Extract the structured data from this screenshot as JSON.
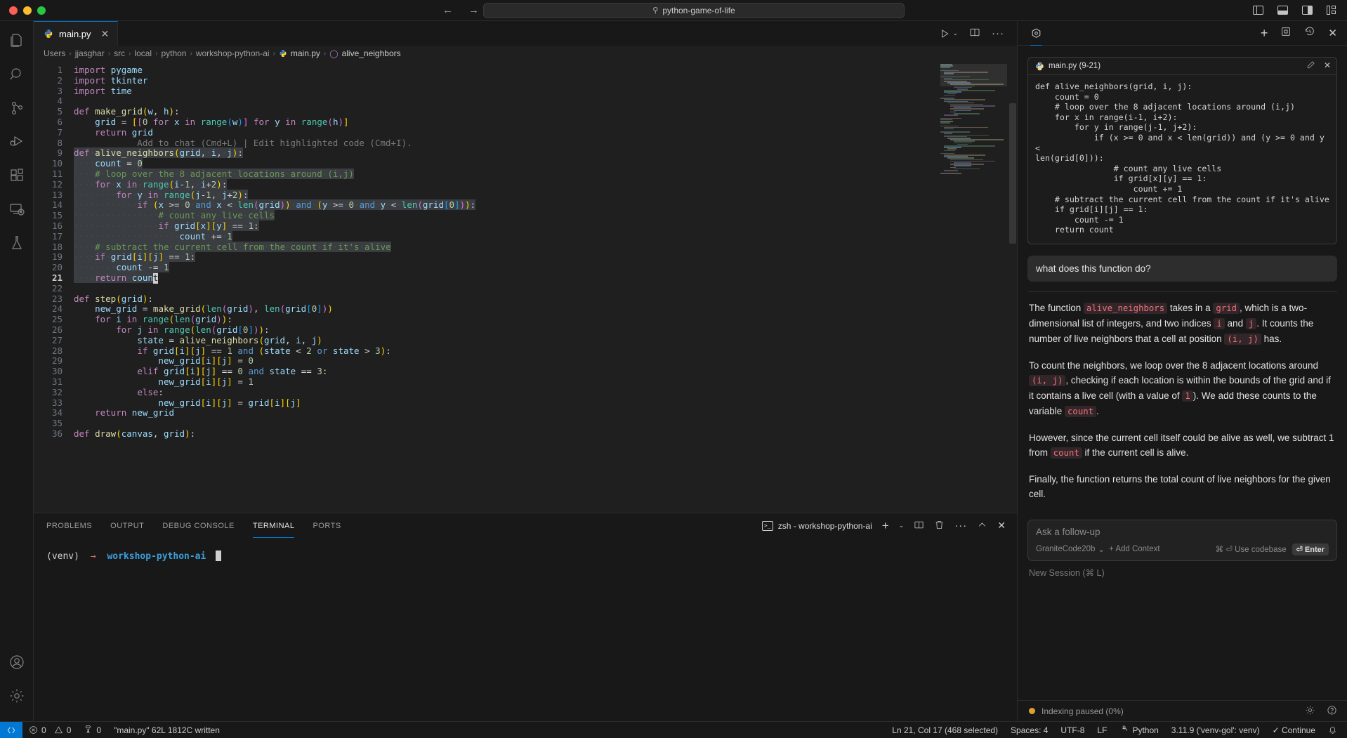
{
  "titlebar": {
    "search_value": "python-game-of-life",
    "search_icon": "search-icon",
    "back_arrow": "←",
    "forward_arrow": "→"
  },
  "activitybar": {
    "items": [
      {
        "name": "explorer",
        "icon": "files-icon"
      },
      {
        "name": "search",
        "icon": "search-icon"
      },
      {
        "name": "source-control",
        "icon": "source-control-icon"
      },
      {
        "name": "run-and-debug",
        "icon": "run-debug-icon"
      },
      {
        "name": "extensions",
        "icon": "extensions-icon"
      },
      {
        "name": "remote-explorer",
        "icon": "remote-explorer-icon"
      },
      {
        "name": "testing",
        "icon": "beaker-icon"
      }
    ],
    "bottom": [
      {
        "name": "accounts",
        "icon": "account-icon"
      },
      {
        "name": "settings",
        "icon": "gear-icon"
      }
    ]
  },
  "editor": {
    "tab": {
      "label": "main.py",
      "icon": "python-icon",
      "close": "✕"
    },
    "tab_actions": {
      "run": "run-icon",
      "chevron": "⌄",
      "split": "split-editor-icon",
      "more": "···"
    },
    "breadcrumb": [
      "Users",
      "jjasghar",
      "src",
      "local",
      "python",
      "workshop-python-ai",
      "main.py",
      "alive_neighbors"
    ],
    "breadcrumb_separator": "›",
    "inline_hint": "Add to chat (Cmd+L) | Edit highlighted code (Cmd+I).",
    "first_line": 1,
    "cursor_line": 21,
    "lines": [
      {
        "n": 1,
        "text": "import pygame"
      },
      {
        "n": 2,
        "text": "import tkinter"
      },
      {
        "n": 3,
        "text": "import time"
      },
      {
        "n": 4,
        "text": ""
      },
      {
        "n": 5,
        "text": "def make_grid(w, h):"
      },
      {
        "n": 6,
        "text": "    grid = [[0 for x in range(w)] for y in range(h)]"
      },
      {
        "n": 7,
        "text": "    return grid"
      },
      {
        "n": 8,
        "text": ""
      },
      {
        "n": 9,
        "text": "def alive_neighbors(grid, i, j):"
      },
      {
        "n": 10,
        "text": "    count = 0"
      },
      {
        "n": 11,
        "text": "    # loop over the 8 adjacent locations around (i,j)"
      },
      {
        "n": 12,
        "text": "    for x in range(i-1, i+2):"
      },
      {
        "n": 13,
        "text": "        for y in range(j-1, j+2):"
      },
      {
        "n": 14,
        "text": "            if (x >= 0 and x < len(grid)) and (y >= 0 and y < len(grid[0])):"
      },
      {
        "n": 15,
        "text": "                # count any live cells"
      },
      {
        "n": 16,
        "text": "                if grid[x][y] == 1:"
      },
      {
        "n": 17,
        "text": "                    count += 1"
      },
      {
        "n": 18,
        "text": "    # subtract the current cell from the count if it's alive"
      },
      {
        "n": 19,
        "text": "    if grid[i][j] == 1:"
      },
      {
        "n": 20,
        "text": "        count -= 1"
      },
      {
        "n": 21,
        "text": "    return count"
      },
      {
        "n": 22,
        "text": ""
      },
      {
        "n": 23,
        "text": "def step(grid):"
      },
      {
        "n": 24,
        "text": "    new_grid = make_grid(len(grid), len(grid[0]))"
      },
      {
        "n": 25,
        "text": "    for i in range(len(grid)):"
      },
      {
        "n": 26,
        "text": "        for j in range(len(grid[0])):"
      },
      {
        "n": 27,
        "text": "            state = alive_neighbors(grid, i, j)"
      },
      {
        "n": 28,
        "text": "            if grid[i][j] == 1 and (state < 2 or state > 3):"
      },
      {
        "n": 29,
        "text": "                new_grid[i][j] = 0"
      },
      {
        "n": 30,
        "text": "            elif grid[i][j] == 0 and state == 3:"
      },
      {
        "n": 31,
        "text": "                new_grid[i][j] = 1"
      },
      {
        "n": 32,
        "text": "            else:"
      },
      {
        "n": 33,
        "text": "                new_grid[i][j] = grid[i][j]"
      },
      {
        "n": 34,
        "text": "    return new_grid"
      },
      {
        "n": 35,
        "text": ""
      },
      {
        "n": 36,
        "text": "def draw(canvas, grid):"
      }
    ]
  },
  "panel": {
    "tabs": [
      {
        "label": "PROBLEMS",
        "active": false
      },
      {
        "label": "OUTPUT",
        "active": false
      },
      {
        "label": "DEBUG CONSOLE",
        "active": false
      },
      {
        "label": "TERMINAL",
        "active": true
      },
      {
        "label": "PORTS",
        "active": false
      }
    ],
    "terminal_name": "zsh - workshop-python-ai",
    "actions": {
      "new": "+",
      "chevron": "⌄",
      "split": "split-terminal-icon",
      "kill": "trash-icon",
      "more": "···",
      "maximize": "chevron-up-icon",
      "close": "✕"
    },
    "prompt": {
      "venv": "(venv)",
      "arrow": "→",
      "dir": "workshop-python-ai"
    }
  },
  "continue_panel": {
    "logo": "continue-logo-icon",
    "header_actions": {
      "new": "+",
      "expand": "expand-icon",
      "history": "history-icon",
      "close": "✕"
    },
    "context_card": {
      "title": "main.py (9-21)",
      "icon": "python-icon",
      "actions": {
        "edit": "pencil-icon",
        "close": "✕"
      },
      "code": "def alive_neighbors(grid, i, j):\n    count = 0\n    # loop over the 8 adjacent locations around (i,j)\n    for x in range(i-1, i+2):\n        for y in range(j-1, j+2):\n            if (x >= 0 and x < len(grid)) and (y >= 0 and y <\nlen(grid[0])):\n                # count any live cells\n                if grid[x][y] == 1:\n                    count += 1\n    # subtract the current cell from the count if it's alive\n    if grid[i][j] == 1:\n        count -= 1\n    return count"
    },
    "user_message": "what does this function do?",
    "answer_paragraphs": [
      [
        {
          "t": "text",
          "v": "The function "
        },
        {
          "t": "code",
          "v": "alive_neighbors"
        },
        {
          "t": "text",
          "v": " takes in a "
        },
        {
          "t": "code",
          "v": "grid"
        },
        {
          "t": "text",
          "v": ", which is a two-dimensional list of integers, and two indices "
        },
        {
          "t": "code",
          "v": "i"
        },
        {
          "t": "text",
          "v": " and "
        },
        {
          "t": "code",
          "v": "j"
        },
        {
          "t": "text",
          "v": ". It counts the number of live neighbors that a cell at position "
        },
        {
          "t": "code",
          "v": "(i, j)"
        },
        {
          "t": "text",
          "v": " has."
        }
      ],
      [
        {
          "t": "text",
          "v": "To count the neighbors, we loop over the 8 adjacent locations around "
        },
        {
          "t": "code",
          "v": "(i, j)"
        },
        {
          "t": "text",
          "v": ", checking if each location is within the bounds of the grid and if it contains a live cell (with a value of "
        },
        {
          "t": "code",
          "v": "1"
        },
        {
          "t": "text",
          "v": "). We add these counts to the variable "
        },
        {
          "t": "code",
          "v": "count"
        },
        {
          "t": "text",
          "v": "."
        }
      ],
      [
        {
          "t": "text",
          "v": "However, since the current cell itself could be alive as well, we subtract 1 from "
        },
        {
          "t": "code",
          "v": "count"
        },
        {
          "t": "text",
          "v": " if the current cell is alive."
        }
      ],
      [
        {
          "t": "text",
          "v": "Finally, the function returns the total count of live neighbors for the given cell."
        }
      ]
    ],
    "ask_box": {
      "placeholder": "Ask a follow-up",
      "model": "GraniteCode20b",
      "model_chevron": "⌄",
      "add_context": "+ Add Context",
      "use_codebase": "⌘ ⏎ Use codebase",
      "enter_button": "⏎ Enter"
    },
    "new_session": "New Session (⌘ L)",
    "footer": {
      "status": "Indexing paused (0%)",
      "status_color": "#e0a030",
      "gear": "gear-icon",
      "help": "help-icon"
    }
  },
  "statusbar": {
    "remote_icon": "remote-window-icon",
    "errors": "0",
    "warnings": "0",
    "radio_tower": "0",
    "file_status": "\"main.py\" 62L 1812C written",
    "cursor_position": "Ln 21, Col 17 (468 selected)",
    "indentation": "Spaces: 4",
    "encoding": "UTF-8",
    "eol": "LF",
    "language": "Python",
    "interpreter": "3.11.9 ('venv-gol': venv)",
    "continue_status": "✓ Continue",
    "bell": "bell-icon"
  }
}
